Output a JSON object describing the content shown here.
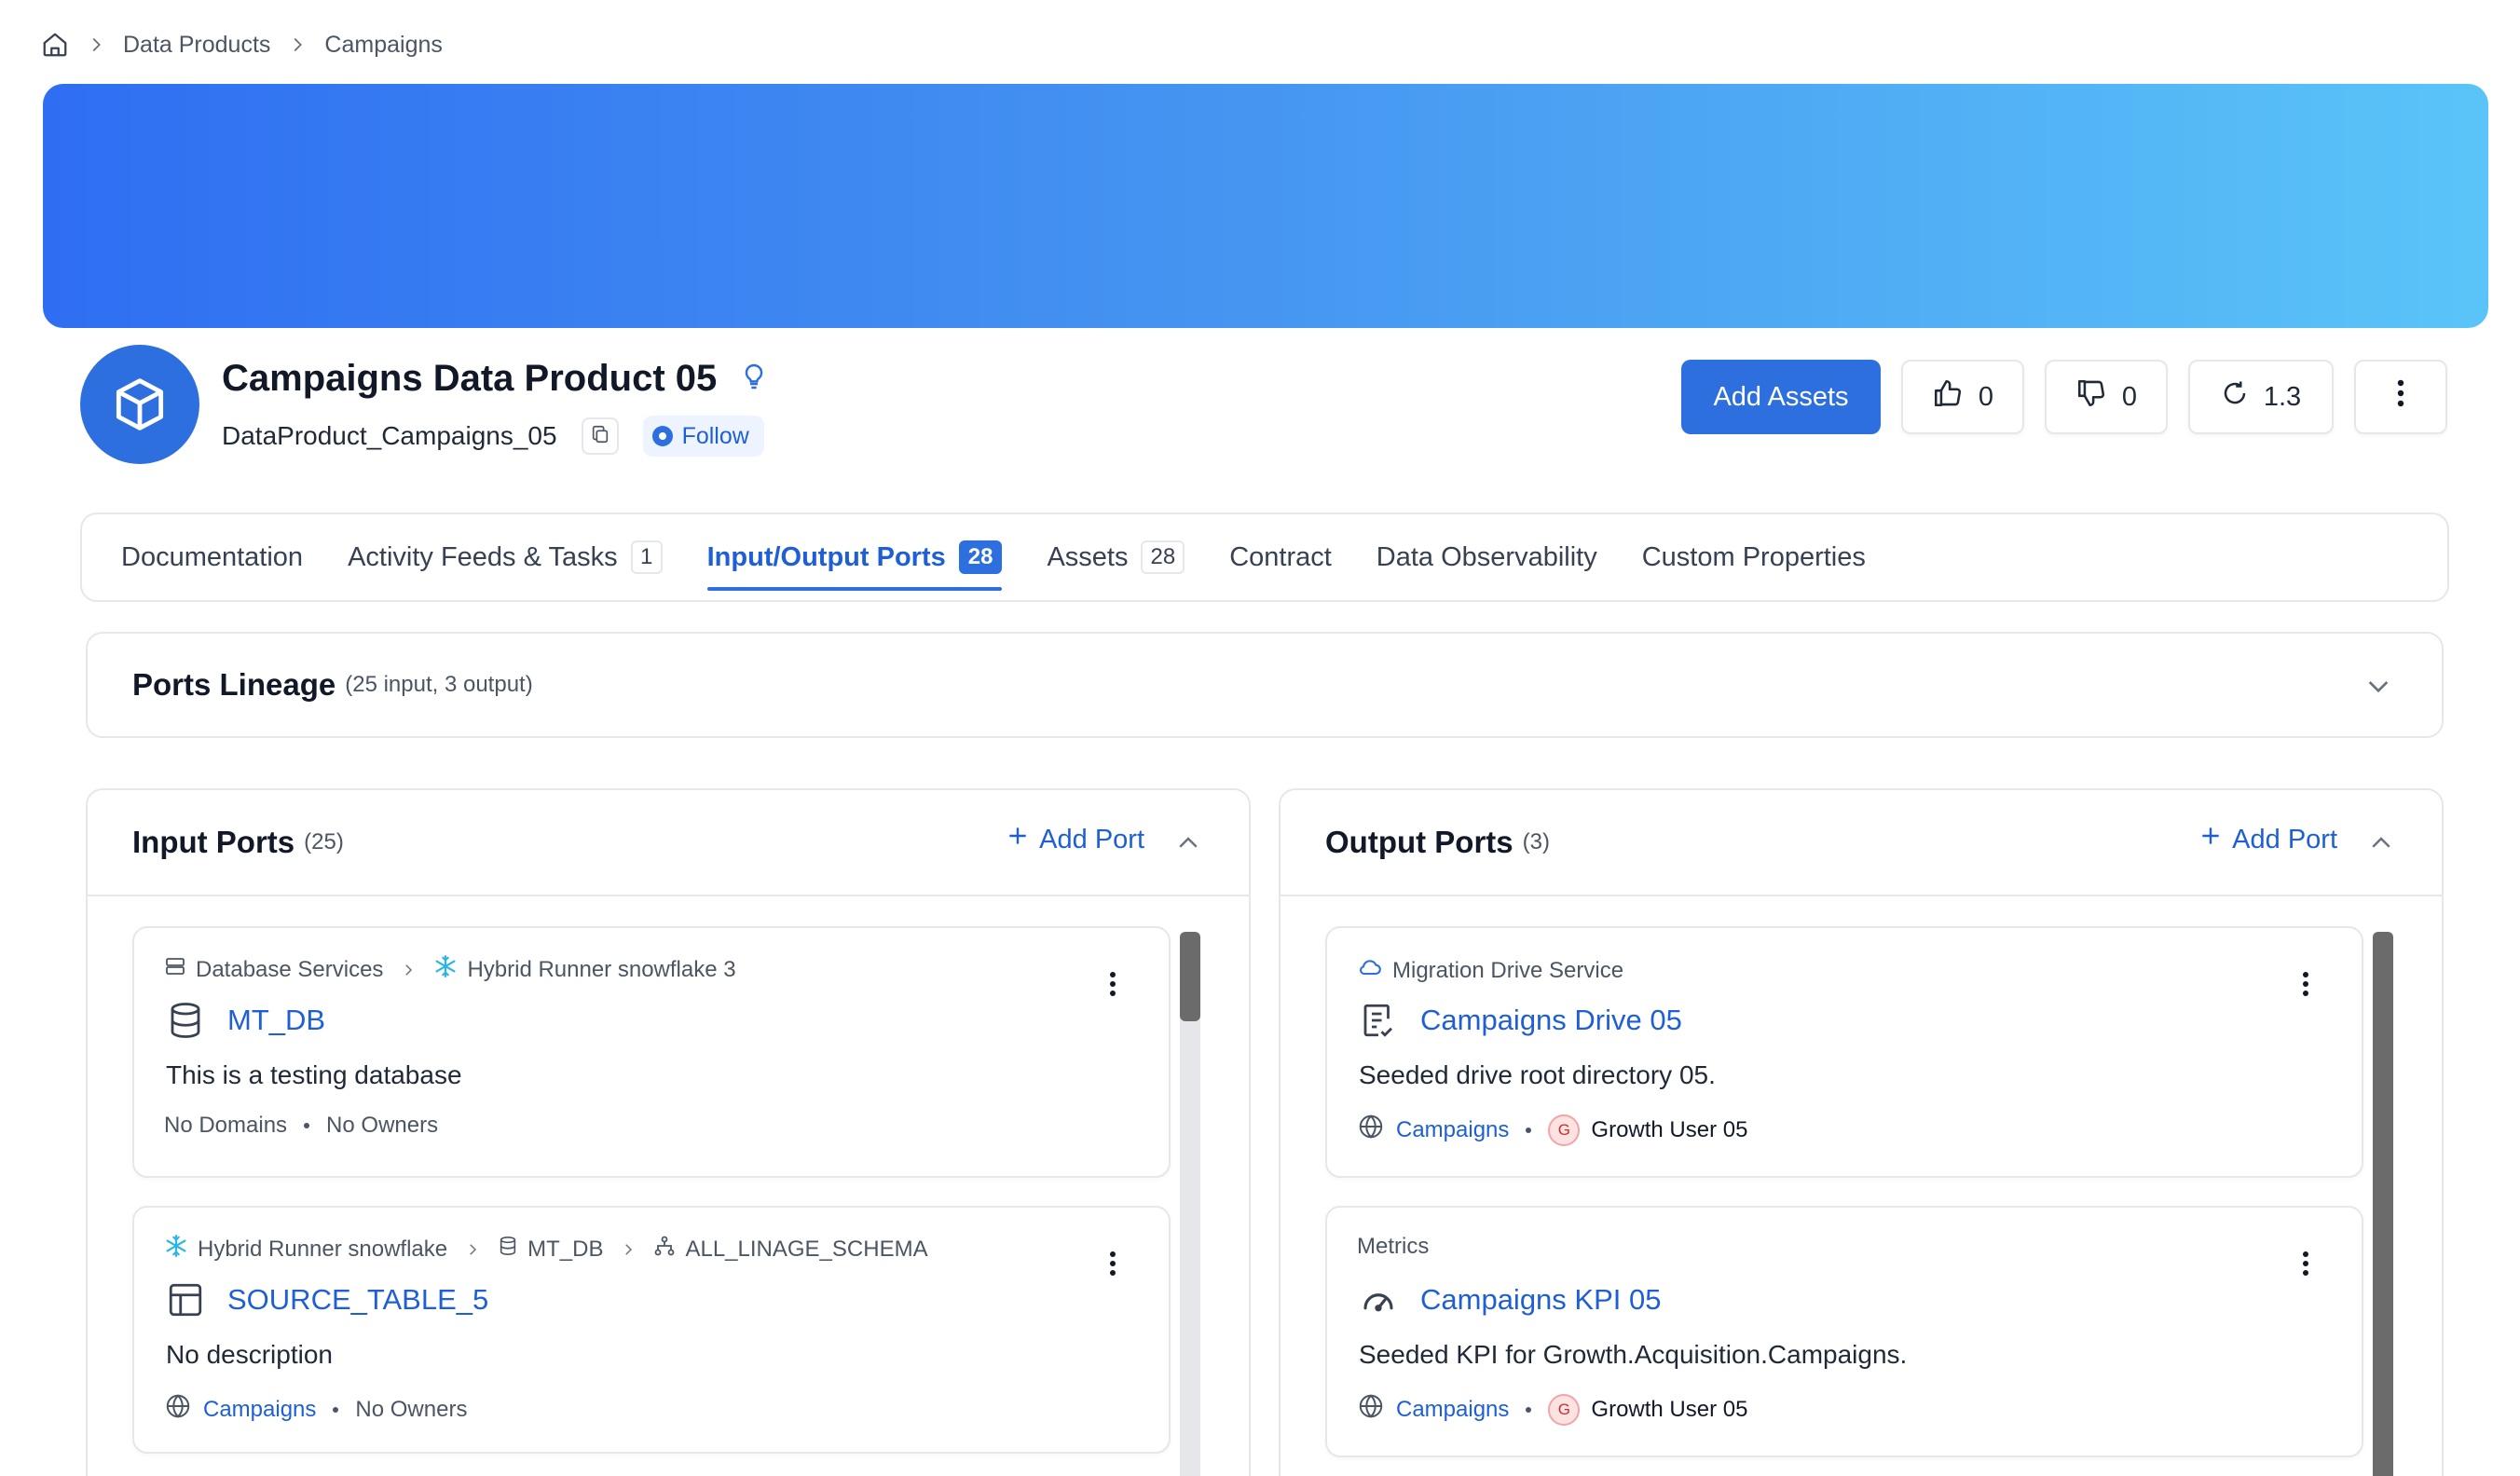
{
  "breadcrumb": {
    "items": [
      "Data Products",
      "Campaigns"
    ]
  },
  "header": {
    "title": "Campaigns Data Product 05",
    "fqn": "DataProduct_Campaigns_05",
    "follow_label": "Follow",
    "add_assets_label": "Add Assets",
    "upvotes": "0",
    "downvotes": "0",
    "version": "1.3"
  },
  "tabs": [
    {
      "label": "Documentation",
      "count": null
    },
    {
      "label": "Activity Feeds & Tasks",
      "count": "1"
    },
    {
      "label": "Input/Output Ports",
      "count": "28",
      "active": true
    },
    {
      "label": "Assets",
      "count": "28"
    },
    {
      "label": "Contract",
      "count": null
    },
    {
      "label": "Data Observability",
      "count": null
    },
    {
      "label": "Custom Properties",
      "count": null
    }
  ],
  "lineage": {
    "title": "Ports Lineage",
    "summary": "(25 input, 3 output)"
  },
  "input_ports": {
    "title": "Input Ports",
    "count": "(25)",
    "add_label": "Add Port",
    "cards": [
      {
        "path": [
          "Database Services",
          "Hybrid Runner snowflake 3"
        ],
        "name": "MT_DB",
        "description": "This is a testing database",
        "domain": "No Domains",
        "owner": "No Owners"
      },
      {
        "path": [
          "Hybrid Runner snowflake",
          "MT_DB",
          "ALL_LINAGE_SCHEMA"
        ],
        "name": "SOURCE_TABLE_5",
        "description": "No description",
        "domain": "Campaigns",
        "owner": "No Owners"
      }
    ]
  },
  "output_ports": {
    "title": "Output Ports",
    "count": "(3)",
    "add_label": "Add Port",
    "cards": [
      {
        "path": [
          "Migration Drive Service"
        ],
        "name": "Campaigns Drive 05",
        "description": "Seeded drive root directory 05.",
        "domain": "Campaigns",
        "owner_initial": "G",
        "owner": "Growth User 05"
      },
      {
        "path": [
          "Metrics"
        ],
        "name": "Campaigns KPI 05",
        "description": "Seeded KPI for Growth.Acquisition.Campaigns.",
        "domain": "Campaigns",
        "owner_initial": "G",
        "owner": "Growth User 05"
      }
    ]
  },
  "colors": {
    "accent": "#2e6fe0",
    "link": "#1f5fd6",
    "banner_start": "#2f6ef2",
    "banner_end": "#5ac4f8"
  }
}
